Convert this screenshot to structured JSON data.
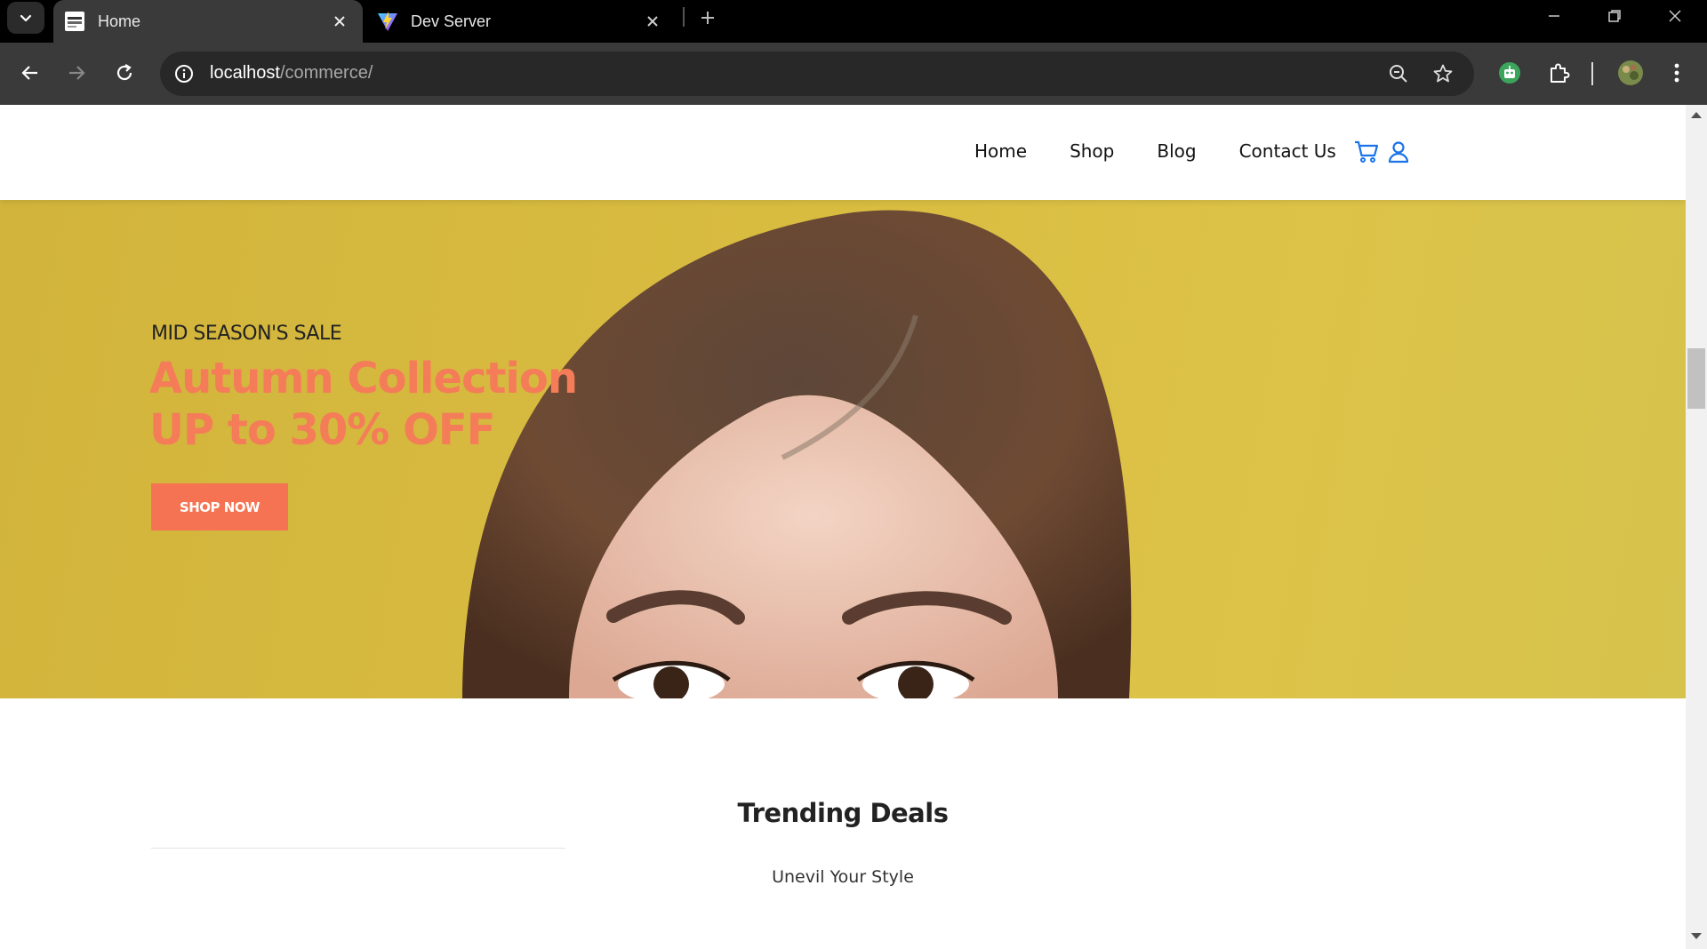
{
  "browser": {
    "tabs": [
      {
        "title": "Home",
        "active": true
      },
      {
        "title": "Dev Server",
        "active": false
      }
    ],
    "url_host": "localhost",
    "url_path": "/commerce/"
  },
  "nav": {
    "links": [
      "Home",
      "Shop",
      "Blog",
      "Contact Us"
    ]
  },
  "hero": {
    "subtitle": "MID SEASON'S SALE",
    "title_line1": "Autumn Collection",
    "title_line2": "UP to 30% OFF",
    "button_label": "SHOP NOW"
  },
  "deals": {
    "title": "Trending Deals",
    "subtitle": "Unevil Your Style"
  },
  "colors": {
    "accent": "#f47c58",
    "button": "#f57352",
    "icon_blue": "#1a73e8",
    "hero_bg": "#d8bc40"
  }
}
